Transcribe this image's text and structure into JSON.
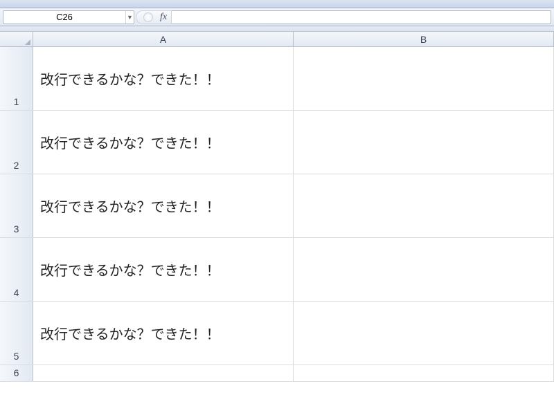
{
  "name_box": {
    "value": "C26"
  },
  "formula_bar": {
    "fx_label": "fx",
    "value": ""
  },
  "columns": [
    {
      "label": "A",
      "key": "A"
    },
    {
      "label": "B",
      "key": "B"
    }
  ],
  "rows": [
    {
      "num": "1",
      "height": "tall",
      "cells": {
        "A": "改行できるかな？できた！！",
        "B": ""
      }
    },
    {
      "num": "2",
      "height": "tall",
      "cells": {
        "A": "改行できるかな？できた！！",
        "B": ""
      }
    },
    {
      "num": "3",
      "height": "tall",
      "cells": {
        "A": "改行できるかな？できた！！",
        "B": ""
      }
    },
    {
      "num": "4",
      "height": "tall",
      "cells": {
        "A": "改行できるかな？できた！！",
        "B": ""
      }
    },
    {
      "num": "5",
      "height": "tall",
      "cells": {
        "A": "改行できるかな？できた！！",
        "B": ""
      }
    },
    {
      "num": "6",
      "height": "short",
      "cells": {
        "A": "",
        "B": ""
      }
    }
  ]
}
